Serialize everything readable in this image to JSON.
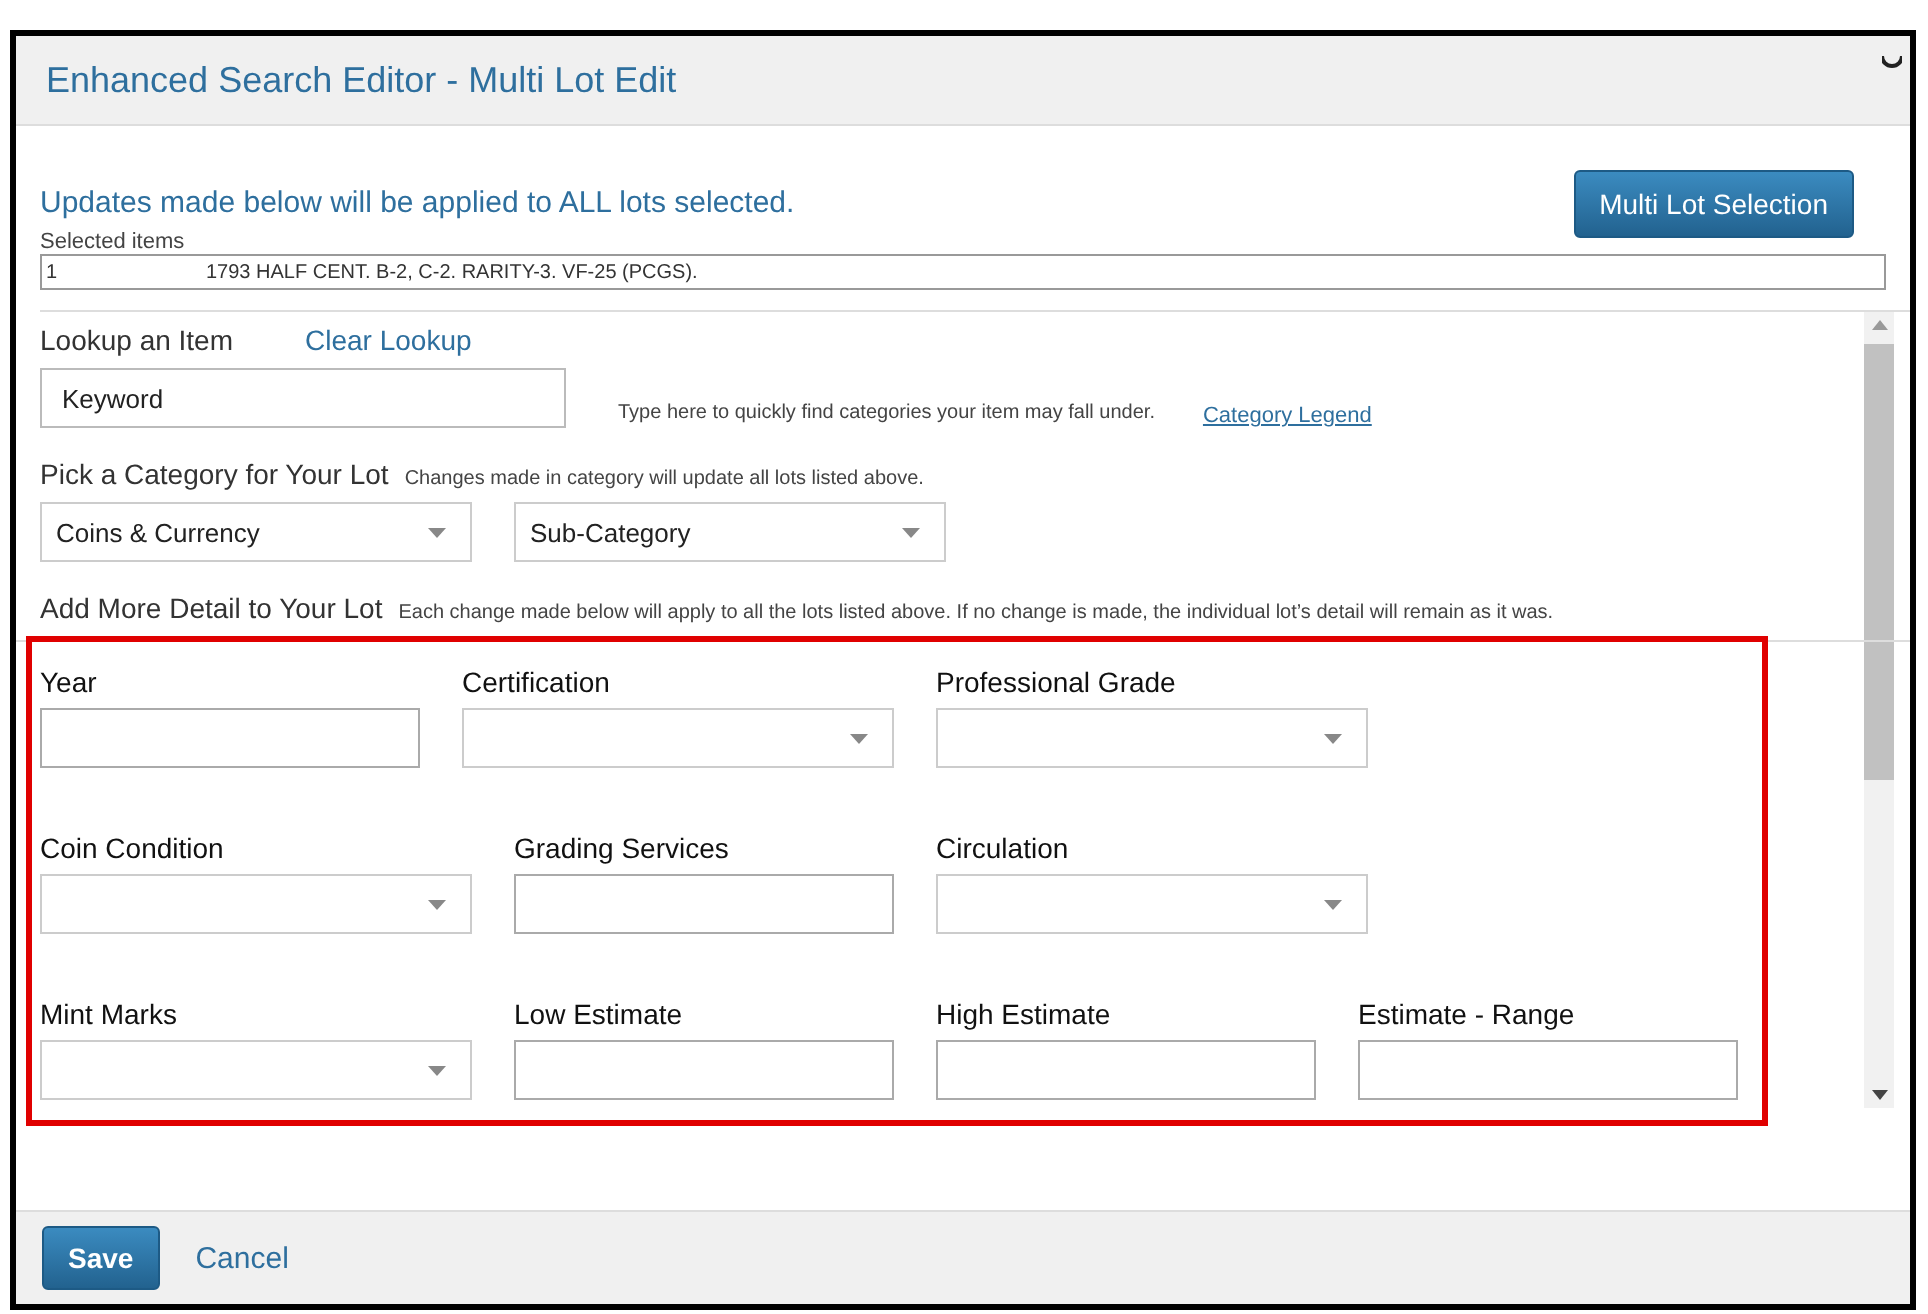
{
  "window": {
    "title": "Enhanced Search Editor - Multi Lot Edit"
  },
  "notice": "Updates made below will be applied to ALL lots selected.",
  "multi_lot_button": "Multi Lot Selection",
  "selected_items": {
    "label": "Selected items",
    "rows": [
      {
        "number": "1",
        "description": "1793 HALF CENT. B-2, C-2. RARITY-3. VF-25 (PCGS)."
      }
    ]
  },
  "lookup": {
    "label": "Lookup an Item",
    "clear_link": "Clear Lookup",
    "placeholder": "Keyword",
    "hint": "Type here to quickly find categories your item may fall under.",
    "legend_link": "Category Legend"
  },
  "category": {
    "label": "Pick a Category for Your Lot",
    "hint": "Changes made in category will update all lots listed above.",
    "selects": [
      {
        "value": "Coins & Currency"
      },
      {
        "value": "Sub-Category"
      }
    ]
  },
  "detail": {
    "label": "Add More Detail to Your Lot",
    "hint": "Each change made below will apply to all the lots listed above. If no change is made, the individual lot’s detail will remain as it was.",
    "rows": [
      [
        {
          "label": "Year",
          "kind": "text"
        },
        {
          "label": "Certification",
          "kind": "select"
        },
        {
          "label": "Professional Grade",
          "kind": "select"
        }
      ],
      [
        {
          "label": "Coin Condition",
          "kind": "select"
        },
        {
          "label": "Grading Services",
          "kind": "text"
        },
        {
          "label": "Circulation",
          "kind": "select"
        }
      ],
      [
        {
          "label": "Mint Marks",
          "kind": "select"
        },
        {
          "label": "Low Estimate",
          "kind": "text"
        },
        {
          "label": "High Estimate",
          "kind": "text"
        },
        {
          "label": "Estimate - Range",
          "kind": "text"
        }
      ]
    ]
  },
  "footer": {
    "save": "Save",
    "cancel": "Cancel"
  }
}
